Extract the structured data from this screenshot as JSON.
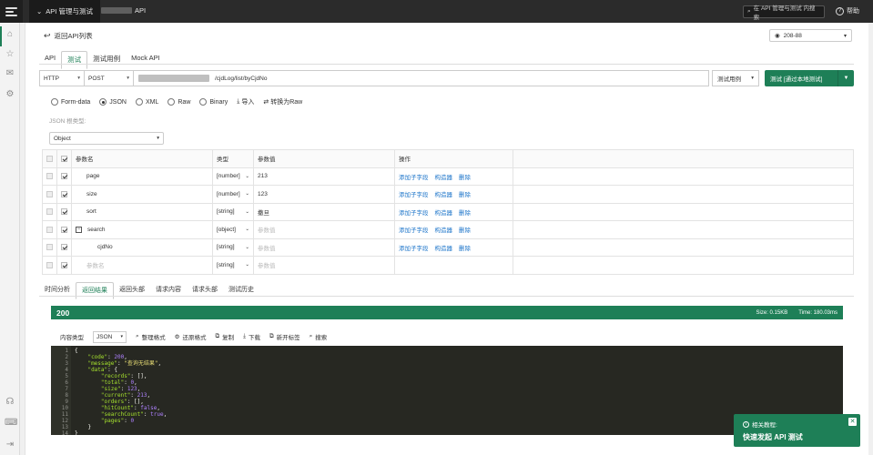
{
  "topbar": {
    "menu_label": "API 管理与测试",
    "project_suffix": "API",
    "search_placeholder": "在 API 管理与测试 内搜索",
    "help_label": "帮助"
  },
  "header": {
    "back_label": "返回API列表",
    "env_value": "208-88"
  },
  "tabs": [
    {
      "label": "API"
    },
    {
      "label": "测试"
    },
    {
      "label": "测试用例"
    },
    {
      "label": "Mock API"
    }
  ],
  "request": {
    "protocol": "HTTP",
    "method": "POST",
    "url_path": "/cjdLog/list/byCjdNo",
    "case_button": "测试用例",
    "test_button": "测试 [通过本地测试]"
  },
  "body_types": [
    {
      "label": "Form-data",
      "selected": false
    },
    {
      "label": "JSON",
      "selected": true
    },
    {
      "label": "XML",
      "selected": false
    },
    {
      "label": "Raw",
      "selected": false
    },
    {
      "label": "Binary",
      "selected": false
    }
  ],
  "import_label": "导入",
  "convert_label": "转换为Raw",
  "json_schema_label": "JSON 根类型:",
  "json_schema_value": "Object",
  "params": {
    "headers": {
      "name": "参数名",
      "type": "类型",
      "value": "参数值",
      "ops": "操作"
    },
    "op_labels": {
      "add_child": "添加子字段",
      "builder": "构造器",
      "delete": "删除"
    },
    "rows": [
      {
        "name": "page",
        "type": "[number]",
        "value": "213",
        "placeholder": false,
        "indent": 1,
        "collapse": false
      },
      {
        "name": "size",
        "type": "[number]",
        "value": "123",
        "placeholder": false,
        "indent": 1,
        "collapse": false
      },
      {
        "name": "sort",
        "type": "[string]",
        "value": "撒旦",
        "placeholder": false,
        "indent": 1,
        "collapse": false
      },
      {
        "name": "search",
        "type": "[object]",
        "value": "参数值",
        "placeholder": true,
        "indent": 1,
        "collapse": true
      },
      {
        "name": "cjdNo",
        "type": "[string]",
        "value": "参数值",
        "placeholder": true,
        "indent": 2,
        "collapse": false
      }
    ],
    "empty_row": {
      "name": "参数名",
      "type": "[string]",
      "value": "参数值"
    }
  },
  "result_tabs": [
    {
      "label": "时间分析"
    },
    {
      "label": "返回结果"
    },
    {
      "label": "返回头部"
    },
    {
      "label": "请求内容"
    },
    {
      "label": "请求头部"
    },
    {
      "label": "测试历史"
    }
  ],
  "response": {
    "status": "200",
    "size": "Size:  0.15KB",
    "time": "Time:  180.03ms",
    "content_type_label": "内容类型",
    "content_type_value": "JSON",
    "tools": [
      {
        "label": "整理格式",
        "icon": "format-icon"
      },
      {
        "label": "还原格式",
        "icon": "restore-icon"
      },
      {
        "label": "复制",
        "icon": "copy-icon"
      },
      {
        "label": "下载",
        "icon": "download-icon"
      },
      {
        "label": "新开标签",
        "icon": "new-tab-icon"
      },
      {
        "label": "搜索",
        "icon": "search-icon"
      }
    ],
    "code_lines": [
      "{",
      "    \"code\": 200,",
      "    \"message\": \"查询无结果\",",
      "    \"data\": {",
      "        \"records\": [],",
      "        \"total\": 0,",
      "        \"size\": 123,",
      "        \"current\": 213,",
      "        \"orders\": [],",
      "        \"hitCount\": false,",
      "        \"searchCount\": true,",
      "        \"pages\": 0",
      "    }",
      "}"
    ]
  },
  "toast": {
    "title": "相关教程:",
    "body": "快速发起 API 测试"
  },
  "colors": {
    "accent": "#1e7f57",
    "link": "#1a73c9",
    "editor_bg": "#272822"
  }
}
